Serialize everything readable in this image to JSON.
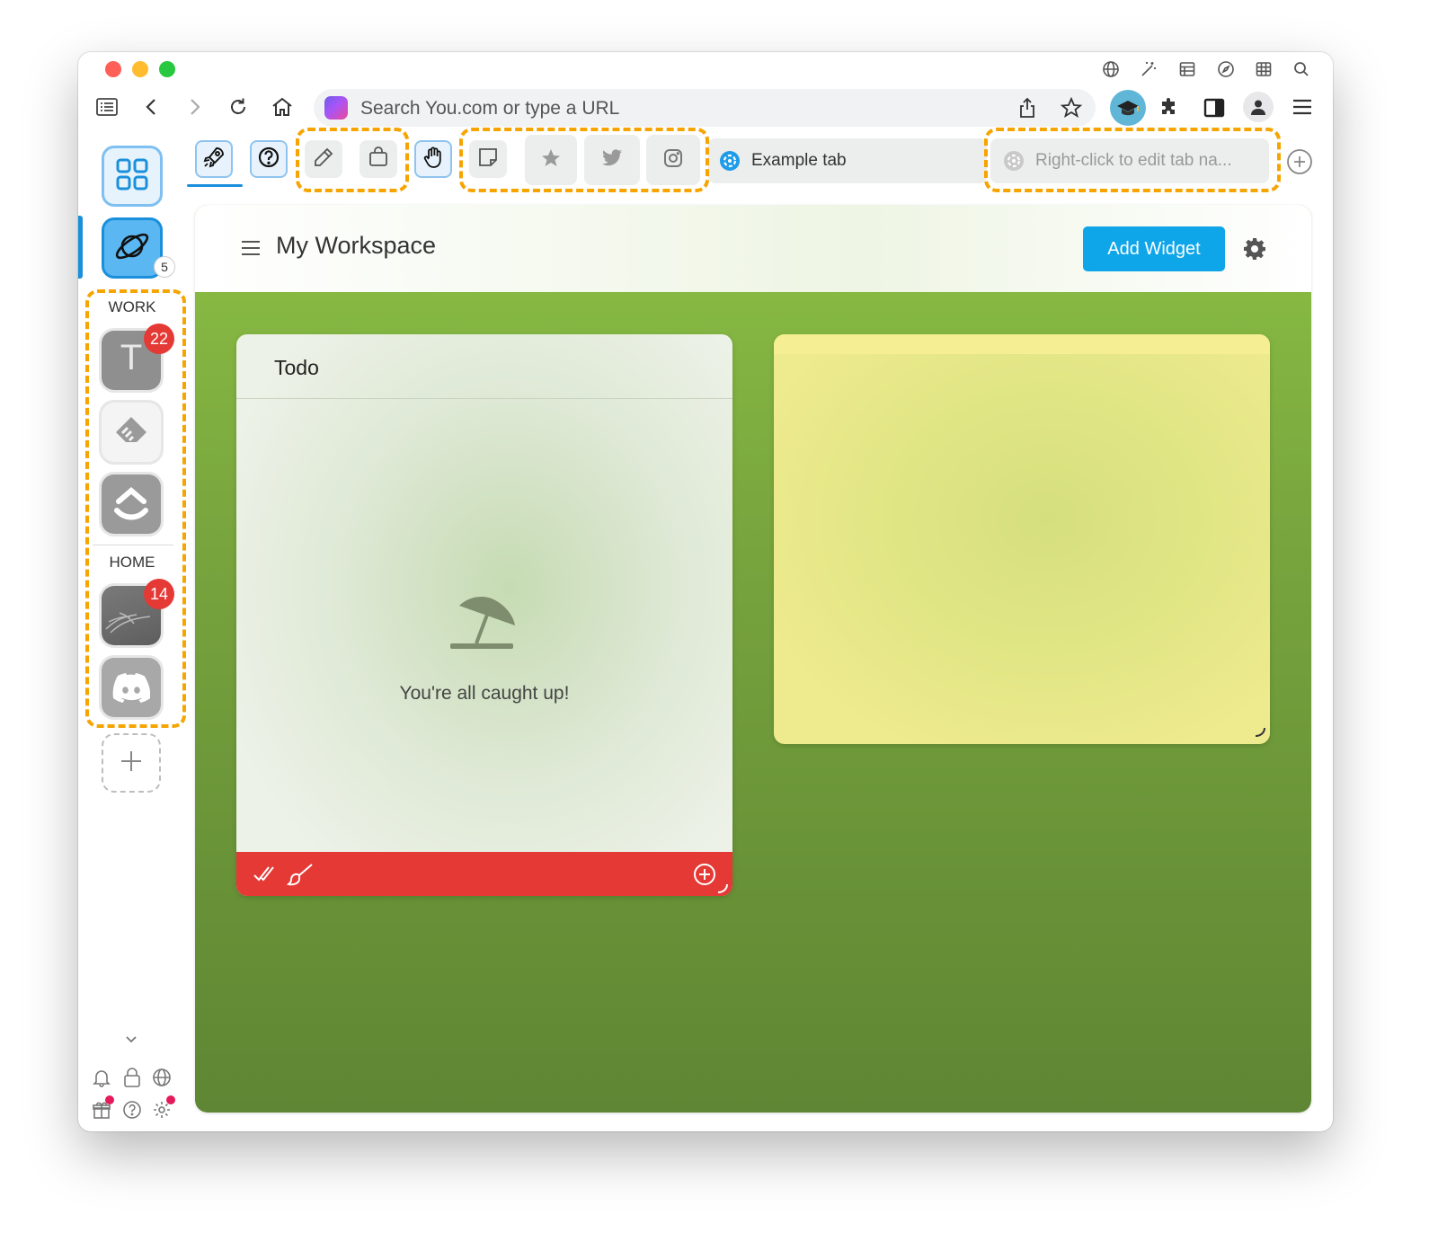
{
  "browser": {
    "url_placeholder": "Search You.com or type a URL"
  },
  "tabs": {
    "example_tab_label": "Example tab",
    "edit_tab_label": "Right-click to edit tab na..."
  },
  "sidebar": {
    "space_badge": "5",
    "groups": {
      "work_label": "WORK",
      "home_label": "HOME"
    },
    "apps": {
      "t_app_letter": "T",
      "t_app_badge": "22",
      "photo_app_badge": "14"
    }
  },
  "workspace": {
    "title": "My Workspace",
    "add_widget_label": "Add Widget"
  },
  "todo_widget": {
    "title": "Todo",
    "empty_message": "You're all caught up!"
  },
  "colors": {
    "accent": "#0ea5e9",
    "badge": "#e53935",
    "highlight": "#f6a400",
    "todo_footer": "#e53935",
    "workspace_green": "#79a63e",
    "note_yellow": "#eeea8e"
  },
  "icons": [
    "globe-icon",
    "magic-wand-icon",
    "table-icon",
    "compass-icon",
    "grid-icon",
    "search-icon",
    "reading-list-icon",
    "back-icon",
    "forward-icon",
    "reload-icon",
    "home-icon",
    "share-icon",
    "star-icon",
    "extensions-icon",
    "sidebar-icon",
    "profile-icon",
    "menu-icon",
    "rocket-icon",
    "help-icon",
    "pencil-icon",
    "shopping-bag-icon",
    "hand-icon",
    "sticky-note-icon",
    "twitter-icon",
    "instagram-icon",
    "plus-icon",
    "dashboard-icon",
    "planet-icon",
    "bell-icon",
    "lock-icon",
    "gift-icon",
    "gear-icon",
    "umbrella-icon",
    "checkmark-icon",
    "brush-icon",
    "chevron-down-icon"
  ]
}
